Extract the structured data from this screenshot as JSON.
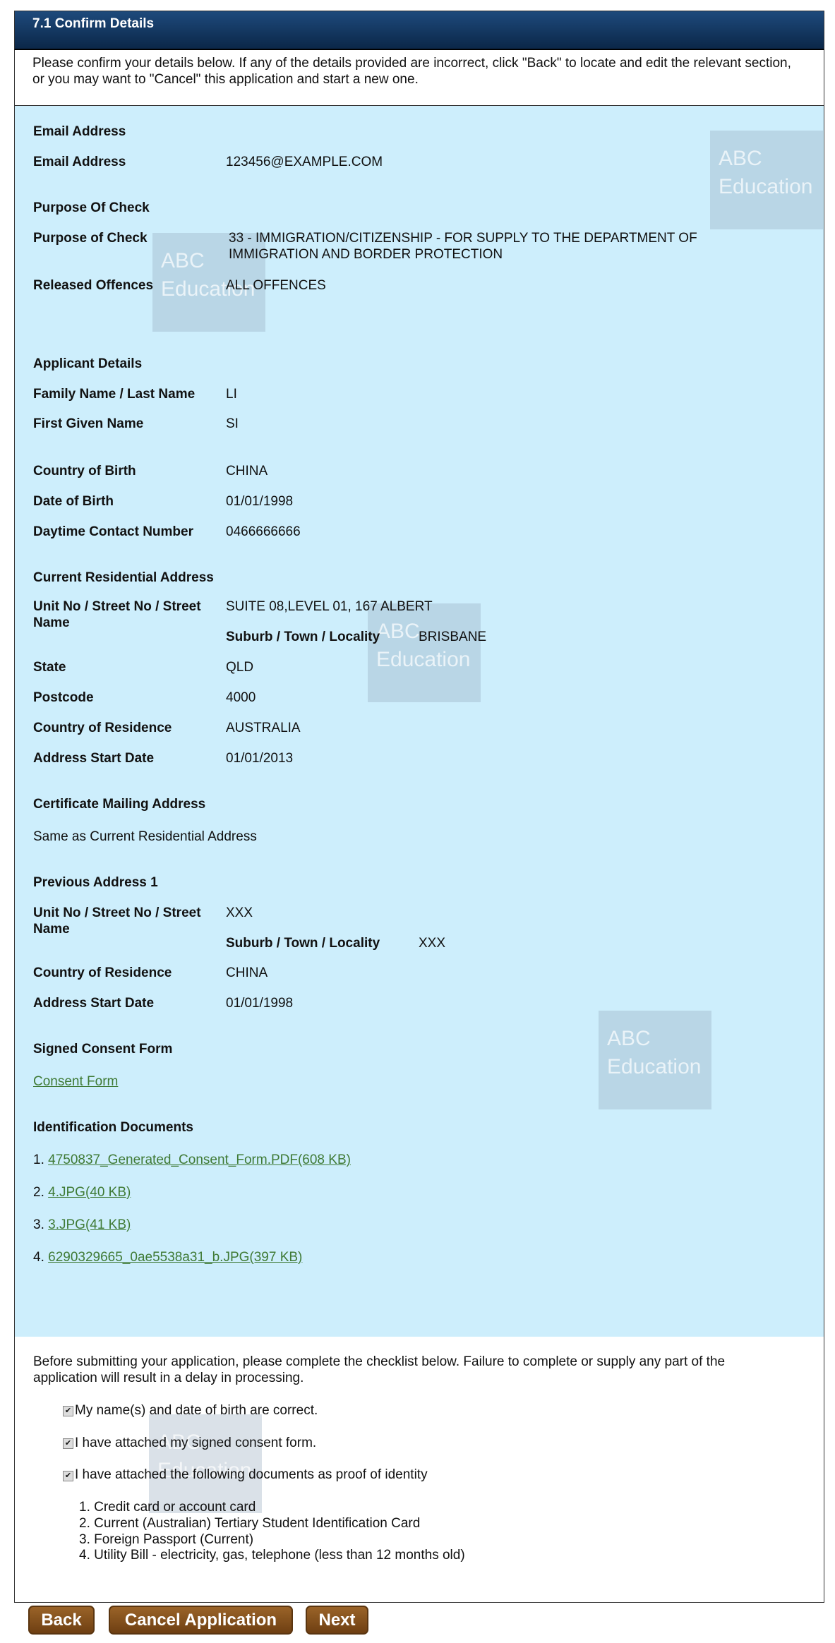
{
  "header": {
    "title": "7.1 Confirm Details"
  },
  "intro": "Please confirm your details below. If any of the details provided are incorrect, click \"Back\" to locate and edit the relevant section, or you may want to \"Cancel\" this application and start a new one.",
  "watermark": {
    "text1": "ABC",
    "text2": "Education"
  },
  "sections": {
    "email": {
      "heading": "Email Address",
      "label": "Email Address",
      "value": "123456@EXAMPLE.COM"
    },
    "purpose": {
      "heading": "Purpose Of Check",
      "purpose_label": "Purpose of Check",
      "purpose_value1": "33 - IMMIGRATION/CITIZENSHIP - FOR SUPPLY TO THE DEPARTMENT OF",
      "purpose_value2": "IMMIGRATION AND BORDER PROTECTION",
      "offences_label": "Released Offences",
      "offences_value": "ALL OFFENCES"
    },
    "applicant": {
      "heading": "Applicant Details",
      "family_label": "Family Name / Last Name",
      "family_value": "LI",
      "given_label": "First Given Name",
      "given_value": "SI",
      "cob_label": "Country of Birth",
      "cob_value": "CHINA",
      "dob_label": "Date of Birth",
      "dob_value": "01/01/1998",
      "phone_label": "Daytime Contact Number",
      "phone_value": "0466666666"
    },
    "current": {
      "heading": "Current Residential Address",
      "street_label1": "Unit No / Street No / Street",
      "street_label2": "Name",
      "street_value": "SUITE 08,LEVEL 01, 167 ALBERT",
      "suburb_label": "Suburb / Town / Locality",
      "suburb_value": "BRISBANE",
      "state_label": "State",
      "state_value": "QLD",
      "postcode_label": "Postcode",
      "postcode_value": "4000",
      "cor_label": "Country of Residence",
      "cor_value": "AUSTRALIA",
      "start_label": "Address Start Date",
      "start_value": "01/01/2013"
    },
    "mailing": {
      "heading": "Certificate Mailing Address",
      "value": "Same as Current Residential Address"
    },
    "previous": {
      "heading": "Previous Address 1",
      "street_label1": "Unit No / Street No / Street",
      "street_label2": "Name",
      "street_value": "XXX",
      "suburb_label": "Suburb / Town / Locality",
      "suburb_value": "XXX",
      "cor_label": "Country of Residence",
      "cor_value": "CHINA",
      "start_label": "Address Start Date",
      "start_value": "01/01/1998"
    },
    "consent": {
      "heading": "Signed Consent Form",
      "link": "Consent Form"
    },
    "documents": {
      "heading": "Identification Documents",
      "items": [
        {
          "num": "1.",
          "link": "4750837_Generated_Consent_Form.PDF(608 KB)"
        },
        {
          "num": "2.",
          "link": "4.JPG(40 KB)"
        },
        {
          "num": "3.",
          "link": "3.JPG(41 KB)"
        },
        {
          "num": "4.",
          "link": "6290329665_0ae5538a31_b.JPG(397 KB)"
        }
      ]
    }
  },
  "checklist": {
    "intro1": "Before submitting your application, please complete the checklist below. Failure to complete or supply any part of the",
    "intro2": "application will result in a delay in processing.",
    "items": [
      {
        "label": "My name(s) and date of birth are correct.",
        "checked": true
      },
      {
        "label": "I have attached my signed consent form.",
        "checked": true
      },
      {
        "label": "I have attached the following documents as proof of identity",
        "checked": true
      }
    ],
    "docs": [
      "1. Credit card or account card",
      "2. Current (Australian) Tertiary Student Identification Card",
      "3. Foreign Passport (Current)",
      "4. Utility Bill - electricity, gas, telephone (less than 12 months old)"
    ]
  },
  "buttons": {
    "back": "Back",
    "cancel": "Cancel Application",
    "next": "Next"
  },
  "colors": {
    "header": "#0b2748",
    "panel": "#cdeefc",
    "link": "#3f7a35",
    "button": "#7a4716"
  }
}
